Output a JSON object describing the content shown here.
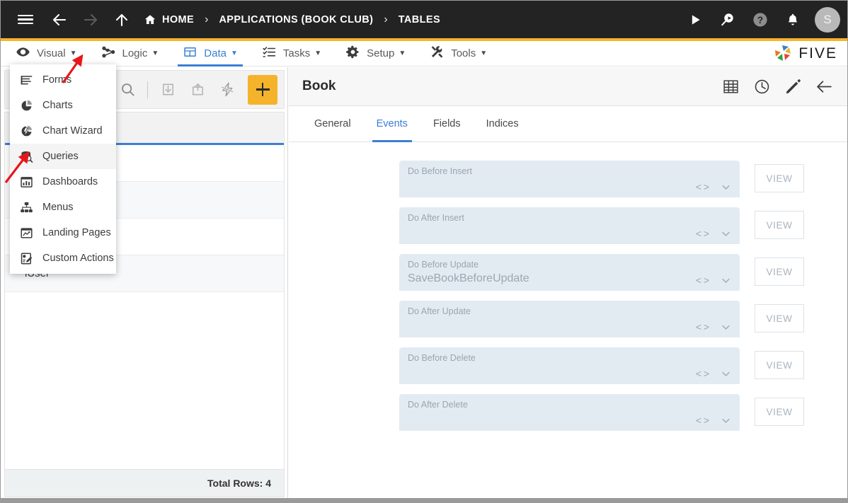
{
  "topbar": {
    "icons": {
      "menu": "hamburger-icon",
      "back": "back-arrow-icon",
      "forward": "forward-arrow-icon",
      "up": "up-arrow-icon",
      "run": "play-icon",
      "search": "search-magnifier-icon",
      "help": "help-circle-icon",
      "notifications": "bell-icon"
    },
    "breadcrumbs": [
      {
        "label": "HOME"
      },
      {
        "label": "APPLICATIONS (BOOK CLUB)"
      },
      {
        "label": "TABLES"
      }
    ],
    "separator": "›",
    "avatar_initial": "S",
    "bg_color": "#232323",
    "accent_rule_color": "#f5b32b"
  },
  "menubar": {
    "items": [
      {
        "label": "Visual",
        "icon": "eye-icon",
        "active": false,
        "caret": "▼"
      },
      {
        "label": "Logic",
        "icon": "logic-nodes-icon",
        "active": false,
        "caret": "▼"
      },
      {
        "label": "Data",
        "icon": "table-grid-icon",
        "active": true,
        "caret": "▼"
      },
      {
        "label": "Tasks",
        "icon": "task-list-icon",
        "active": false,
        "caret": "▼"
      },
      {
        "label": "Setup",
        "icon": "gear-icon",
        "active": false,
        "caret": "▼"
      },
      {
        "label": "Tools",
        "icon": "tools-icon",
        "active": false,
        "caret": "▼"
      }
    ],
    "brand": "FIVE",
    "active_color": "#3a7fd5"
  },
  "visual_dropdown": {
    "open": true,
    "hovered_index": 3,
    "items": [
      {
        "label": "Forms",
        "icon": "forms-lines-icon"
      },
      {
        "label": "Charts",
        "icon": "pie-chart-icon"
      },
      {
        "label": "Chart Wizard",
        "icon": "chart-wizard-icon"
      },
      {
        "label": "Queries",
        "icon": "database-search-icon"
      },
      {
        "label": "Dashboards",
        "icon": "dashboard-icon"
      },
      {
        "label": "Menus",
        "icon": "menu-tree-icon"
      },
      {
        "label": "Landing Pages",
        "icon": "landing-page-icon"
      },
      {
        "label": "Custom Actions",
        "icon": "custom-actions-icon"
      }
    ]
  },
  "left_panel": {
    "toolbar": {
      "icons": [
        {
          "name": "search-icon"
        },
        {
          "name": "import-download-icon"
        },
        {
          "name": "export-upload-icon"
        },
        {
          "name": "lightning-bolt-icon"
        }
      ],
      "add_button": "add-plus-button",
      "add_button_color": "#f5b32b"
    },
    "rows": [
      {
        "label": ""
      },
      {
        "label": ""
      },
      {
        "label": ""
      },
      {
        "label": "iUser"
      }
    ],
    "footer_text": "Total Rows: 4"
  },
  "right_panel": {
    "title": "Book",
    "header_icons": [
      {
        "name": "table-view-icon"
      },
      {
        "name": "history-clock-icon"
      },
      {
        "name": "edit-pencil-icon"
      },
      {
        "name": "back-arrow-icon"
      }
    ],
    "tabs": [
      {
        "label": "General",
        "active": false
      },
      {
        "label": "Events",
        "active": true
      },
      {
        "label": "Fields",
        "active": false
      },
      {
        "label": "Indices",
        "active": false
      }
    ],
    "view_button_label": "VIEW",
    "code_icon": "code-brackets-icon",
    "chevron_icon": "chevron-down-icon",
    "events": [
      {
        "label": "Do Before Insert",
        "value": ""
      },
      {
        "label": "Do After Insert",
        "value": ""
      },
      {
        "label": "Do Before Update",
        "value": "SaveBookBeforeUpdate"
      },
      {
        "label": "Do After Update",
        "value": ""
      },
      {
        "label": "Do Before Delete",
        "value": ""
      },
      {
        "label": "Do After Delete",
        "value": ""
      }
    ]
  },
  "annotations": {
    "arrow_color": "#e8161a",
    "arrows": [
      {
        "name": "arrow-pointing-visual-menu"
      },
      {
        "name": "arrow-pointing-queries-item"
      }
    ]
  }
}
